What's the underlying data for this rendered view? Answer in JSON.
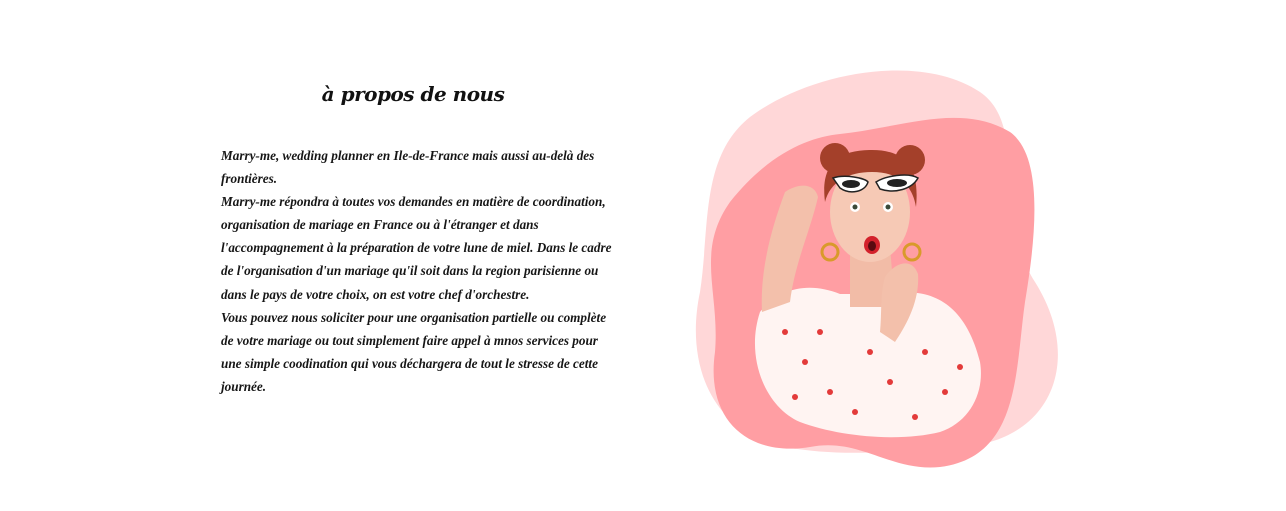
{
  "about": {
    "title": "à propos de nous",
    "paragraphs": [
      "Marry-me, wedding planner en Ile-de-France mais aussi au-delà des frontières.",
      "Marry-me répondra à toutes vos demandes en matière de coordination, organisation de mariage en France ou à l'étranger et dans l'accompagnement à la préparation de votre lune de miel. Dans le cadre de l'organisation d'un mariage qu'il soit dans la region parisienne ou dans le pays de votre choix, on est votre chef d'orchestre.",
      "Vous pouvez nous soliciter pour une organisation partielle ou complète de votre mariage ou tout simplement faire appel à mnos services pour une simple coodination qui vous déchargera de tout le stresse de cette journée."
    ]
  },
  "colors": {
    "blob_light": "#ffd6d6",
    "blob_main": "#ff9aa0",
    "dress": "#fff5f3",
    "hair": "#a8442a",
    "skin": "#f4c3ae"
  }
}
